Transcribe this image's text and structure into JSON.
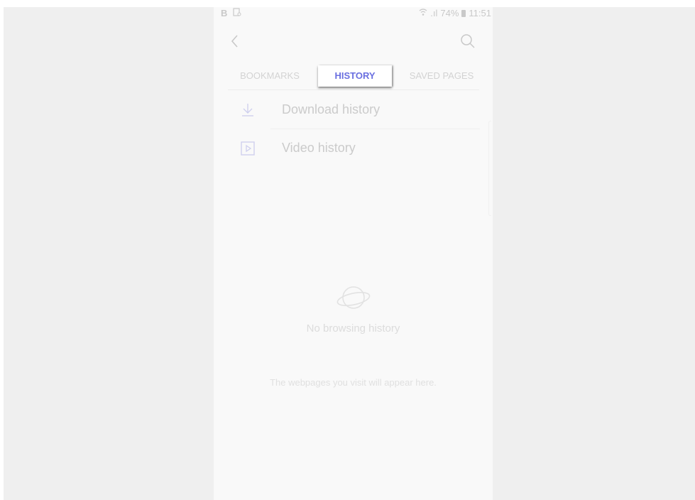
{
  "status_bar": {
    "left_text": "B",
    "signal": ".ıl",
    "battery": "74%",
    "time": "11:51"
  },
  "app_bar": {
    "back_icon": "chevron-left-icon",
    "search_icon": "search-icon"
  },
  "tabs": [
    {
      "label": "BOOKMARKS",
      "selected": false
    },
    {
      "label": "HISTORY",
      "selected": true
    },
    {
      "label": "SAVED PAGES",
      "selected": false
    }
  ],
  "list": [
    {
      "label": "Download history",
      "icon": "download-icon"
    },
    {
      "label": "Video history",
      "icon": "video-icon"
    }
  ],
  "empty_state": {
    "icon": "globe-icon",
    "title": "No browsing history",
    "subtitle": "The webpages you visit will appear here."
  },
  "colors": {
    "accent": "#6a6fe0",
    "muted_text": "#cbcbcb",
    "background": "#f9f9f9"
  }
}
